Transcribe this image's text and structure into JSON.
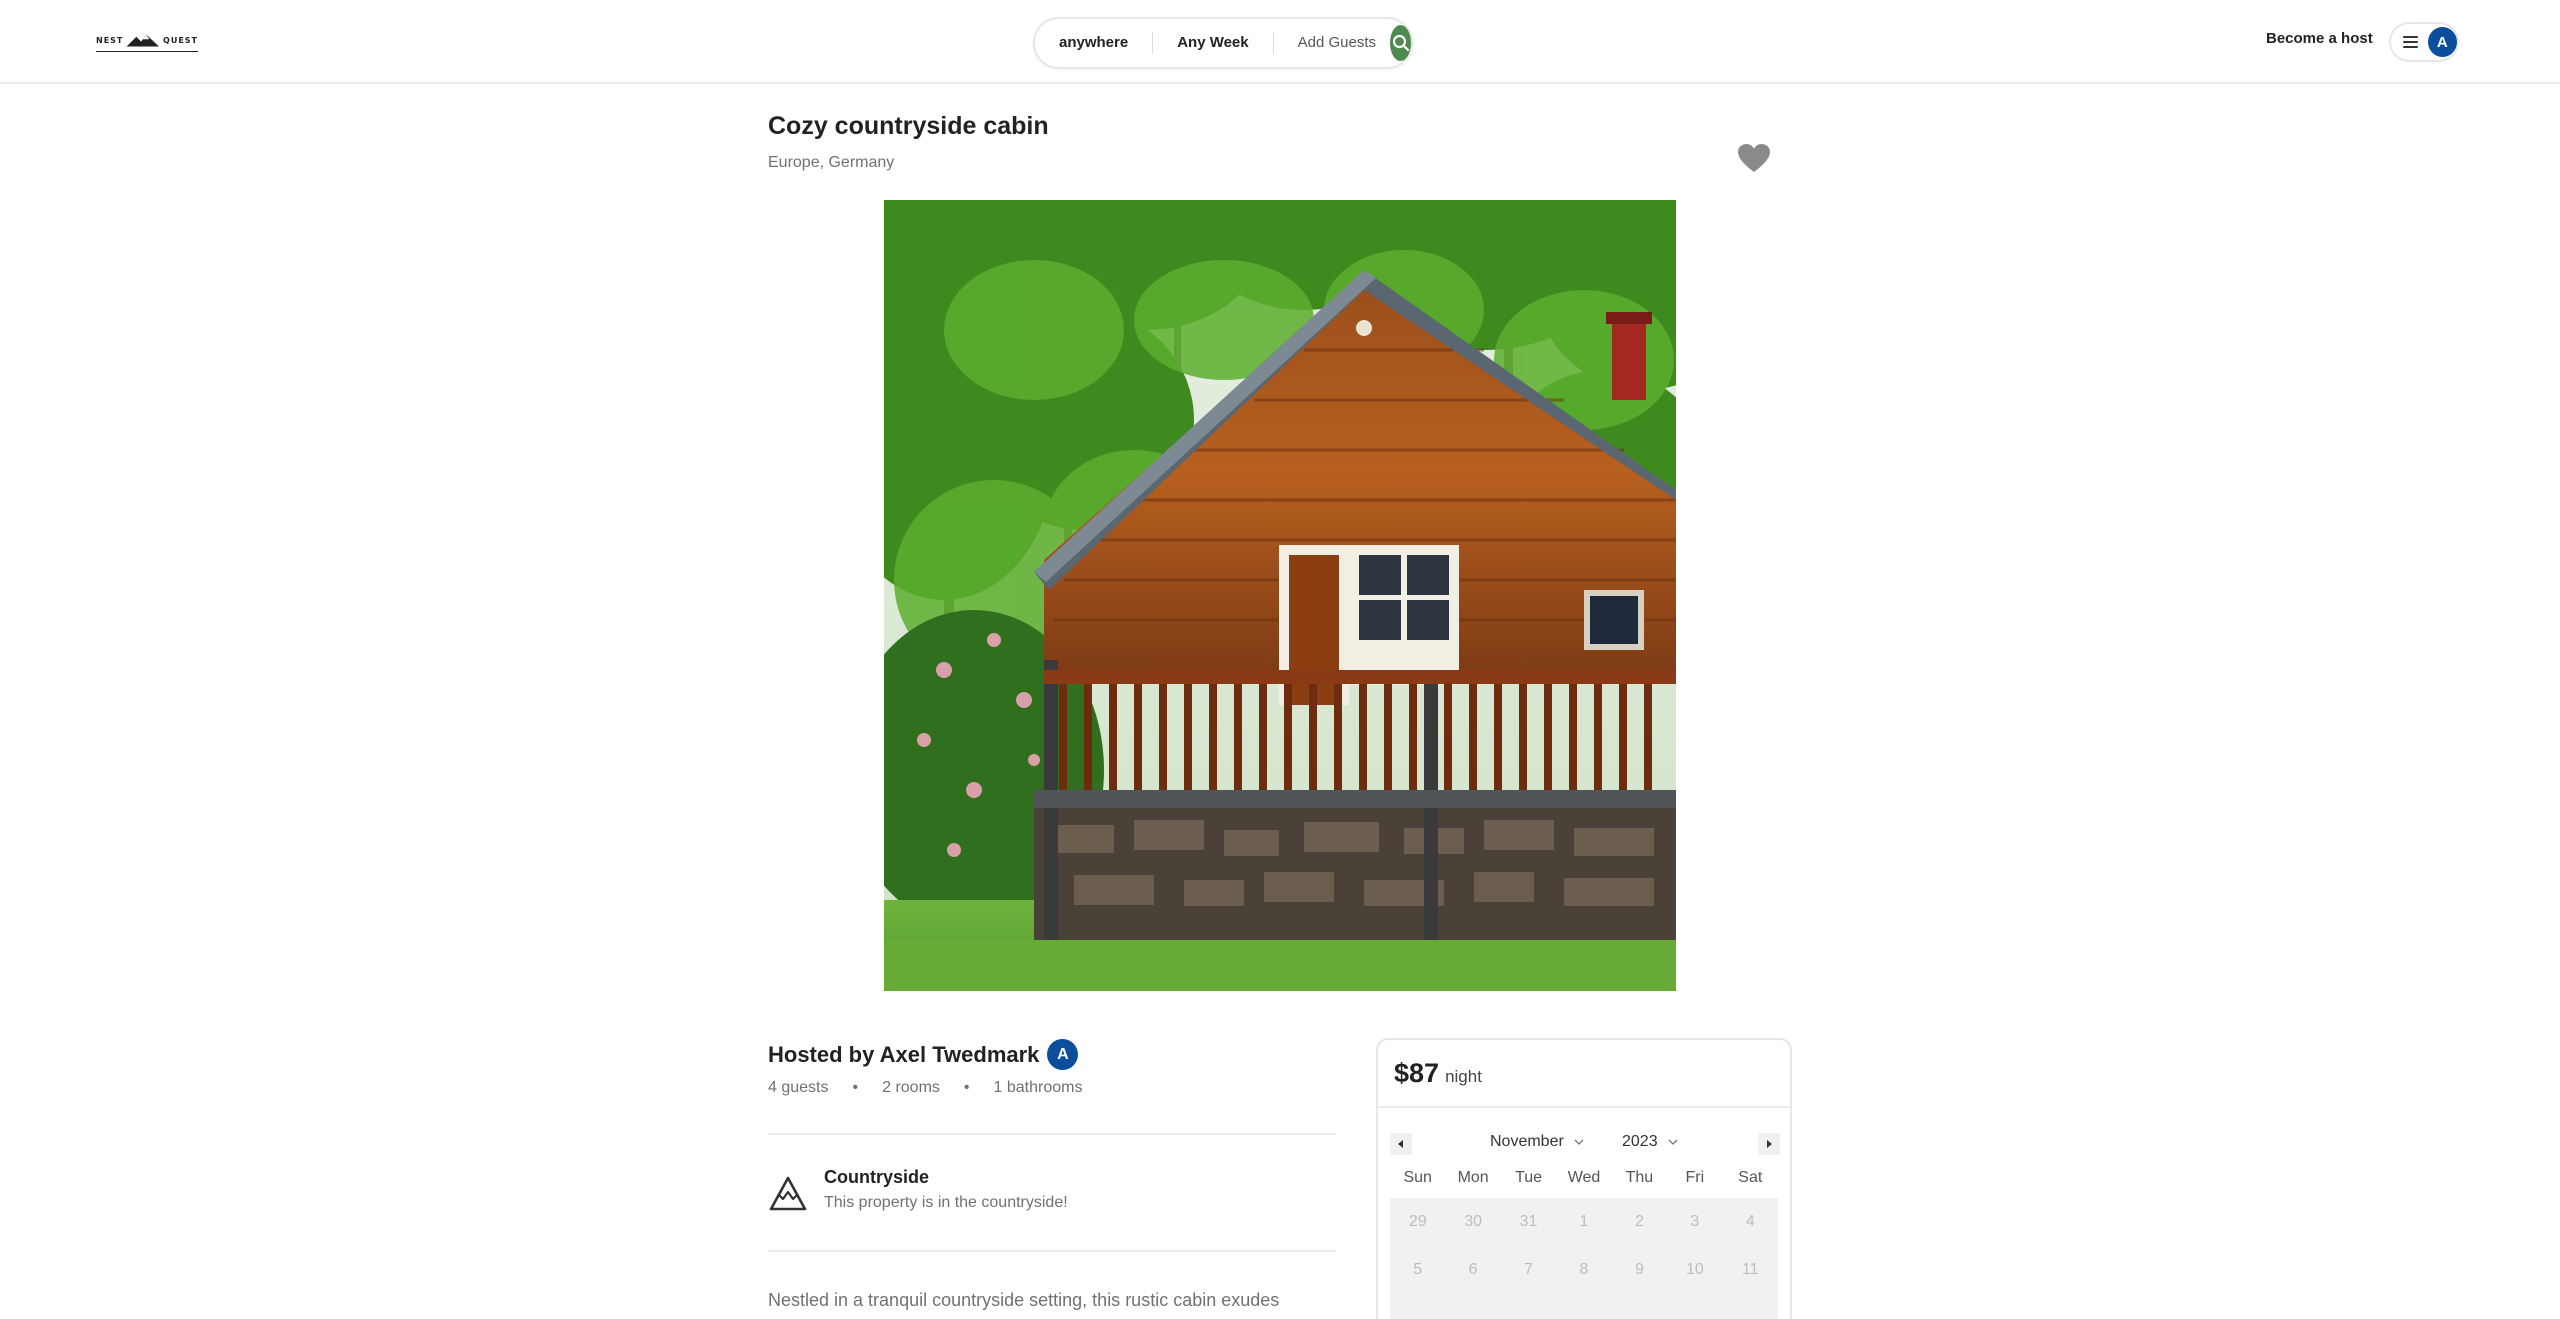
{
  "header": {
    "logo": {
      "left": "NEST",
      "right": "QUEST"
    },
    "search": {
      "location": "anywhere",
      "week": "Any Week",
      "guests": "Add Guests"
    },
    "become_host": "Become a host",
    "avatar_initial": "A"
  },
  "listing": {
    "title": "Cozy countryside cabin",
    "location": "Europe, Germany",
    "photo_icon": "cabin-photo"
  },
  "host": {
    "hosted_by": "Hosted by Axel Twedmark",
    "avatar_initial": "A",
    "guests": "4 guests",
    "rooms": "2 rooms",
    "bathrooms": "1 bathrooms",
    "separator": "•"
  },
  "category": {
    "icon": "mountain-icon",
    "label": "Countryside",
    "description": "This property is in the countryside!"
  },
  "description": "Nestled in a tranquil countryside setting, this rustic cabin exudes charm.",
  "reservation": {
    "price": "$87",
    "unit": "night",
    "calendar": {
      "month": "November",
      "year": "2023",
      "weekdays": [
        "Sun",
        "Mon",
        "Tue",
        "Wed",
        "Thu",
        "Fri",
        "Sat"
      ],
      "weeks": [
        [
          "29",
          "30",
          "31",
          "1",
          "2",
          "3",
          "4"
        ],
        [
          "5",
          "6",
          "7",
          "8",
          "9",
          "10",
          "11"
        ]
      ]
    }
  },
  "colors": {
    "search_button": "#4f8a4f",
    "avatar": "#0b4f9c",
    "heart": "#8a8a8a",
    "muted_text": "#717171"
  }
}
